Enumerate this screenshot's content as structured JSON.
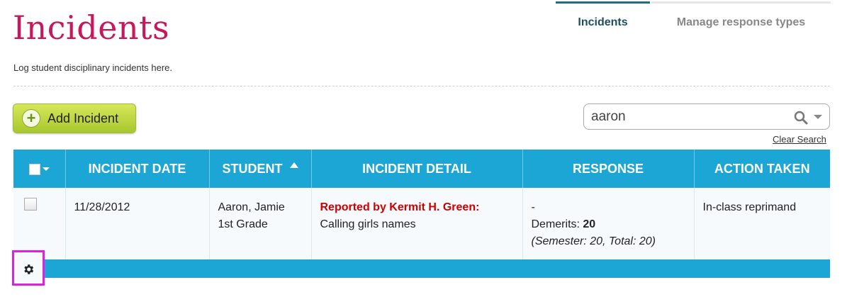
{
  "page": {
    "title": "Incidents",
    "description": "Log student disciplinary incidents here."
  },
  "tabs": [
    {
      "label": "Incidents",
      "active": true
    },
    {
      "label": "Manage response types",
      "active": false
    }
  ],
  "toolbar": {
    "add_label": "Add Incident",
    "search_value": "aaron",
    "clear_search_label": "Clear Search"
  },
  "table": {
    "columns": [
      "INCIDENT DATE",
      "STUDENT",
      "INCIDENT DETAIL",
      "RESPONSE",
      "ACTION TAKEN"
    ],
    "sorted_column": "STUDENT",
    "rows": [
      {
        "date": "11/28/2012",
        "student_name": "Aaron, Jamie",
        "student_grade": "1st Grade",
        "reported_by": "Reported by Kermit H. Green:",
        "detail": "Calling girls names",
        "response_dash": "-",
        "demerits_label": "Demerits:",
        "demerits_value": "20",
        "demerits_summary": "(Semester: 20, Total: 20)",
        "action": "In-class reprimand"
      }
    ]
  },
  "colors": {
    "title": "#c4195d",
    "header": "#1ba6d5",
    "reported": "#d00000",
    "add_button": "#b9d43c",
    "highlight": "#e020e0"
  },
  "icons": {
    "add": "plus-circle-icon",
    "search": "search-icon",
    "settings": "gear-icon"
  }
}
